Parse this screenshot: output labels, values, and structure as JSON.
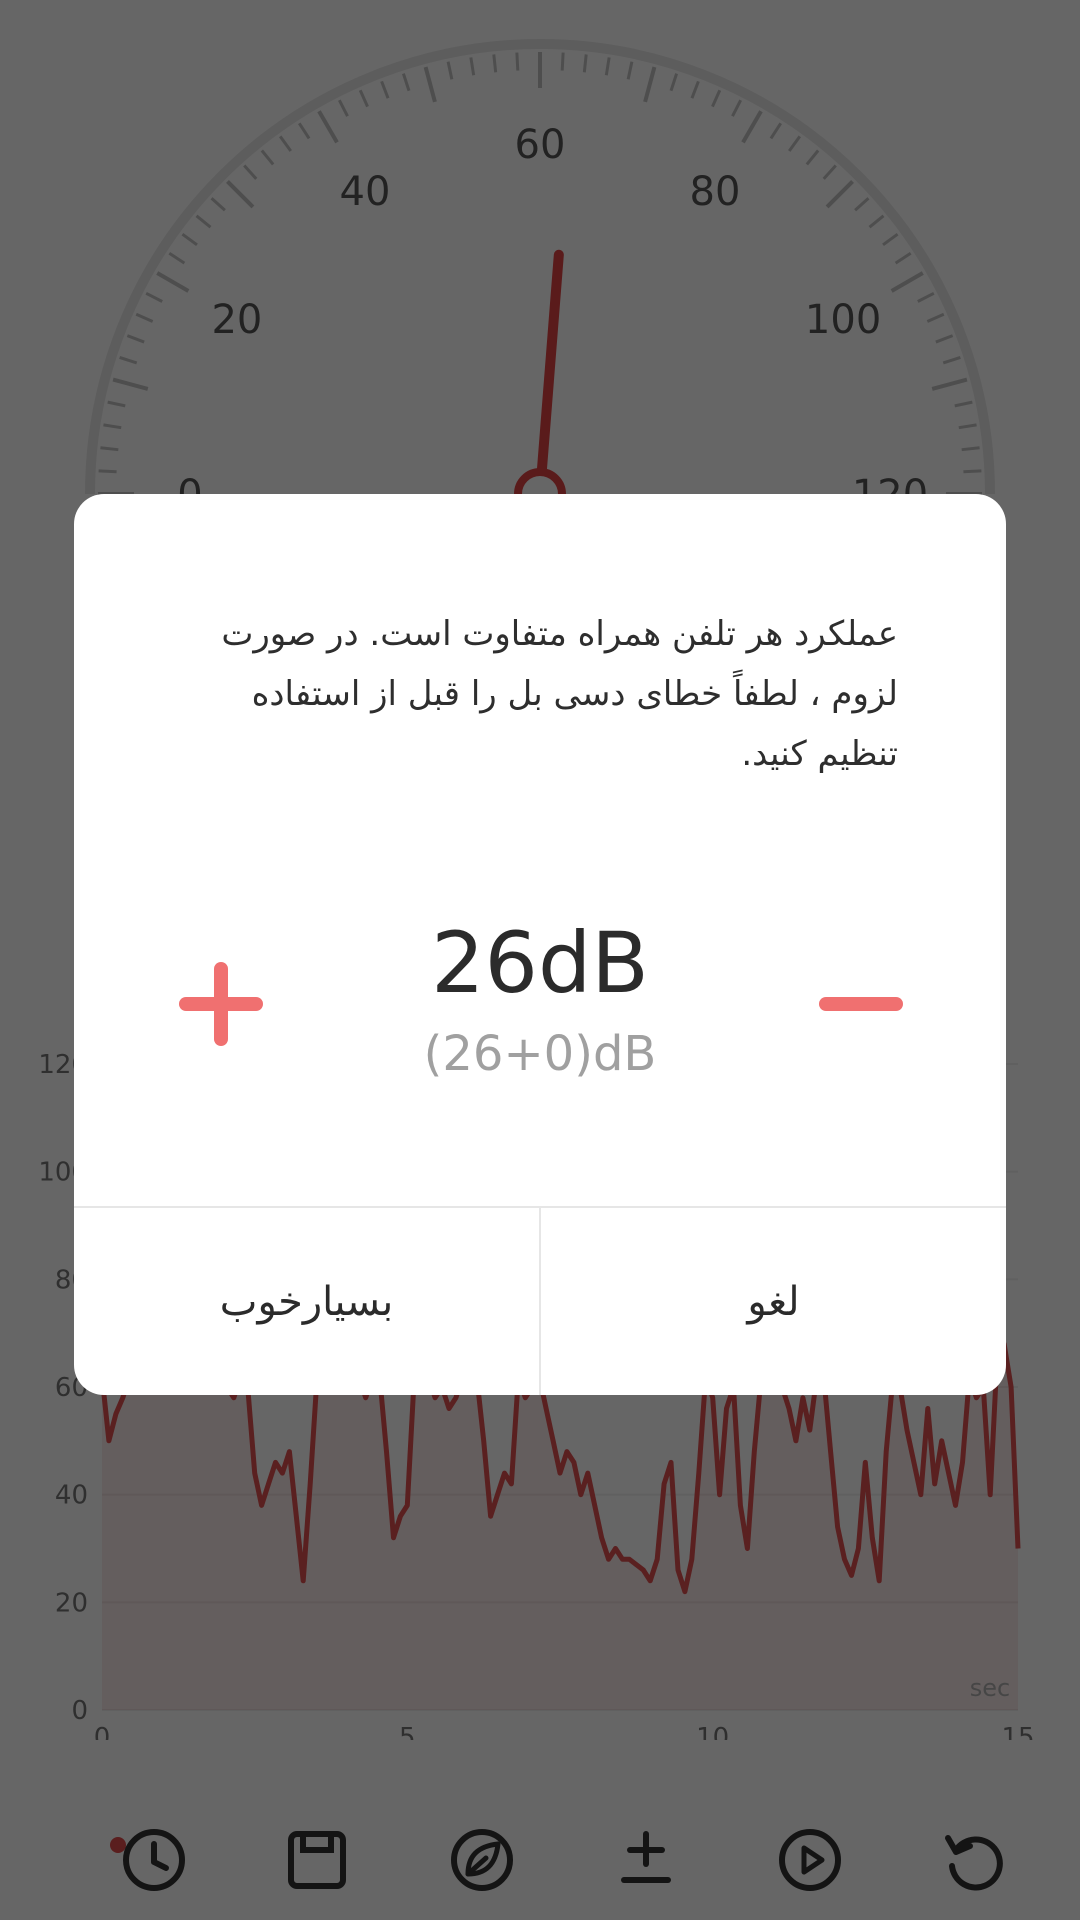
{
  "meter": {
    "dial_labels": [
      "0",
      "20",
      "40",
      "60",
      "80",
      "100",
      "120"
    ],
    "needle_value": 63
  },
  "graph": {
    "y_ticks": [
      "0",
      "20",
      "40",
      "60",
      "80",
      "100",
      "120"
    ],
    "x_ticks": [
      "0",
      "5",
      "10",
      "15"
    ],
    "unit_label": "sec",
    "y_range": [
      0,
      120
    ],
    "x_range": [
      0,
      15
    ],
    "series": [
      62,
      50,
      55,
      58,
      62,
      62,
      64,
      60,
      62,
      60,
      62,
      62,
      62,
      62,
      60,
      62,
      64,
      62,
      60,
      58,
      62,
      60,
      44,
      38,
      42,
      46,
      44,
      48,
      36,
      24,
      42,
      62,
      60,
      60,
      62,
      64,
      60,
      62,
      58,
      62,
      62,
      48,
      32,
      36,
      38,
      62,
      60,
      62,
      58,
      60,
      56,
      58,
      62,
      60,
      62,
      50,
      36,
      40,
      44,
      42,
      62,
      58,
      60,
      62,
      56,
      50,
      44,
      48,
      46,
      40,
      44,
      38,
      32,
      28,
      30,
      28,
      28,
      27,
      26,
      24,
      28,
      42,
      46,
      26,
      22,
      28,
      44,
      62,
      58,
      40,
      56,
      60,
      38,
      30,
      48,
      62,
      64,
      60,
      60,
      56,
      50,
      58,
      52,
      62,
      62,
      48,
      34,
      28,
      25,
      30,
      46,
      32,
      24,
      48,
      62,
      60,
      52,
      46,
      40,
      56,
      42,
      50,
      44,
      38,
      46,
      62,
      58,
      60,
      40,
      66,
      68,
      60,
      30
    ],
    "color": "#e05050"
  },
  "toolbar": {
    "icons": [
      "history-icon",
      "save-icon",
      "leaf-icon",
      "calibrate-icon",
      "play-icon",
      "reset-icon"
    ]
  },
  "dialog": {
    "message": "عملکرد هر تلفن همراه متفاوت است. در صورت لزوم ، لطفاً خطای دسی بل را قبل از استفاده تنظیم کنید.",
    "value_main": "26dB",
    "value_sub": "(26+0)dB",
    "accent": "#f07070",
    "ok_label": "بسیارخوب",
    "cancel_label": "لغو"
  }
}
